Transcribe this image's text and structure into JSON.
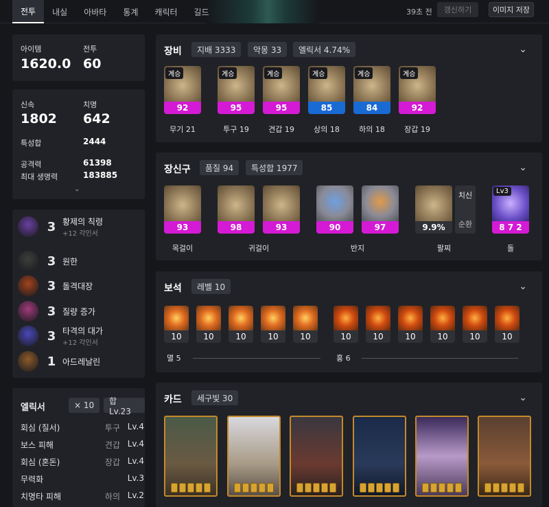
{
  "tabs": [
    "전투",
    "내실",
    "아바타",
    "통계",
    "캐릭터",
    "길드"
  ],
  "topbar": {
    "time": "39초 전",
    "refresh": "갱신하기",
    "save": "이미지 저장"
  },
  "summary": {
    "item_label": "아이템",
    "item_value": "1620.0",
    "combat_label": "전투",
    "combat_value": "60"
  },
  "stats": {
    "swift_label": "신속",
    "swift_value": "1802",
    "crit_label": "치명",
    "crit_value": "642",
    "total_label": "특성합",
    "total_value": "2444",
    "atk_label": "공격력",
    "atk_value": "61398",
    "hp_label": "최대 생명력",
    "hp_value": "183885"
  },
  "engravings": [
    {
      "level": "3",
      "name": "황제의 칙령",
      "sub": "+12 각인서",
      "color": "#6a3fa0"
    },
    {
      "level": "3",
      "name": "원한",
      "sub": "",
      "color": "#3b3f3a"
    },
    {
      "level": "3",
      "name": "돌격대장",
      "sub": "",
      "color": "#a2431c"
    },
    {
      "level": "3",
      "name": "질량 증가",
      "sub": "",
      "color": "#a03a7a"
    },
    {
      "level": "3",
      "name": "타격의 대가",
      "sub": "+12 각인서",
      "color": "#4a48b8"
    },
    {
      "level": "1",
      "name": "아드레날린",
      "sub": "",
      "color": "#8c5a2a"
    }
  ],
  "elixir": {
    "title": "엘릭서",
    "count": "× 10",
    "total": "합 Lv.23",
    "rows": [
      {
        "name": "회심 (질서)",
        "part": "투구",
        "level": "Lv.4"
      },
      {
        "name": "보스 피해",
        "part": "견갑",
        "level": "Lv.4"
      },
      {
        "name": "회심 (혼돈)",
        "part": "장갑",
        "level": "Lv.4"
      },
      {
        "name": "무력화",
        "part": "",
        "level": "Lv.3"
      },
      {
        "name": "치명타 피해",
        "part": "하의",
        "level": "Lv.2"
      }
    ]
  },
  "equipment": {
    "title": "장비",
    "chips": [
      "지배 3333",
      "악몽 33",
      "엘릭서 4.74%"
    ],
    "items": [
      {
        "tag": "계승",
        "quality": "92",
        "color": "#d41ad4",
        "label": "무기 21"
      },
      {
        "tag": "계승",
        "quality": "95",
        "color": "#d41ad4",
        "label": "투구 19"
      },
      {
        "tag": "계승",
        "quality": "95",
        "color": "#d41ad4",
        "label": "견갑 19"
      },
      {
        "tag": "계승",
        "quality": "85",
        "color": "#1a6ad4",
        "label": "상의 18"
      },
      {
        "tag": "계승",
        "quality": "84",
        "color": "#1a6ad4",
        "label": "하의 18"
      },
      {
        "tag": "계승",
        "quality": "92",
        "color": "#d41ad4",
        "label": "장갑 19"
      }
    ]
  },
  "accessories": {
    "title": "장신구",
    "chips": [
      "품질 94",
      "특성합 1977"
    ],
    "items": [
      {
        "quality": "93",
        "color": "#d41ad4"
      },
      {
        "quality": "98",
        "color": "#d41ad4"
      },
      {
        "quality": "93",
        "color": "#d41ad4"
      },
      {
        "quality": "90",
        "color": "#d41ad4"
      },
      {
        "quality": "97",
        "color": "#d41ad4"
      },
      {
        "quality": "9.9%",
        "color": "#2f3137"
      },
      {
        "quality": "8 7 2",
        "color": "#d41ad4"
      }
    ],
    "bracelet_stats": [
      "치신",
      "순환"
    ],
    "stone_tag": "Lv3",
    "labels": [
      "목걸이",
      "귀걸이",
      "반지",
      "팔찌",
      "돌"
    ]
  },
  "gems": {
    "title": "보석",
    "chip": "레벨 10",
    "levels": [
      "10",
      "10",
      "10",
      "10",
      "10",
      "10",
      "10",
      "10",
      "10",
      "10",
      "10"
    ],
    "left_label": "멸 5",
    "right_label": "홍 6"
  },
  "cards": {
    "title": "카드",
    "chip": "세구빛 30"
  }
}
